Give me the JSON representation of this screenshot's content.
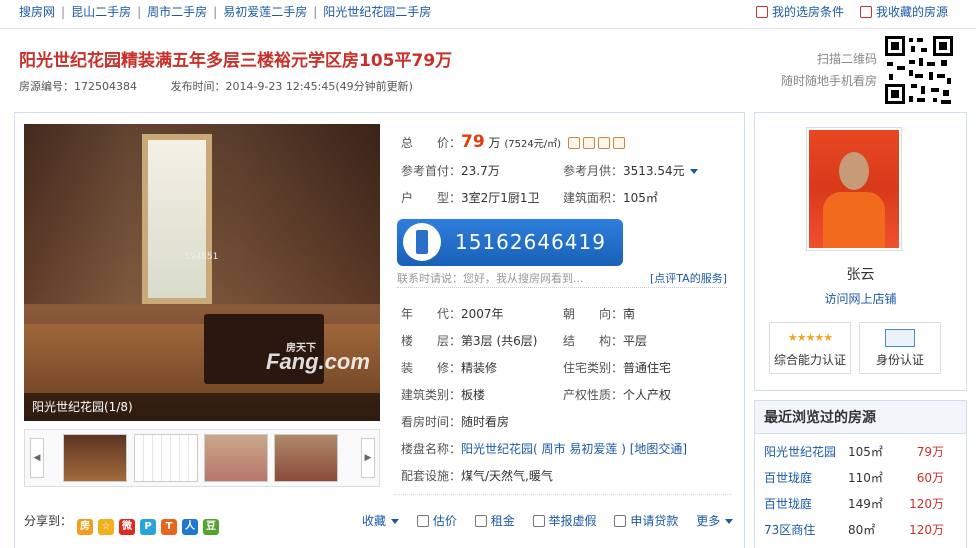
{
  "breadcrumb": [
    "搜房网",
    "昆山二手房",
    "周市二手房",
    "易初爱莲二手房",
    "阳光世纪花园二手房"
  ],
  "breadcrumb_sep": "|",
  "top_links": {
    "conditions": "我的选房条件",
    "favorites": "我收藏的房源"
  },
  "title": "阳光世纪花园精装满五年多层三楼裕元学区房105平79万",
  "meta": {
    "id": "房源编号：172504384",
    "published": "发布时间：2014-9-23 12:45:45(49分钟前更新)"
  },
  "qr": {
    "line1": "扫描二维码",
    "line2": "随时随地手机看房"
  },
  "photo": {
    "caption": "阳光世纪花园(1/8)",
    "watermark": "Fang.com",
    "watermark_small": "房天下",
    "code": "594851"
  },
  "thumbs": {
    "prev": "◀",
    "next": "▶"
  },
  "info": {
    "total_label": "总　　价：",
    "total_value": "79",
    "total_unit": "万",
    "total_extra": "(7524元/㎡)",
    "down_label": "参考首付：",
    "down_value": "23.7万",
    "monthly_label": "参考月供：",
    "monthly_value": "3513.54元",
    "layout_label": "户　　型：",
    "layout_value": "3室2厅1厨1卫",
    "area_label": "建筑面积：",
    "area_value": "105㎡",
    "year_label": "年　　代：",
    "year_value": "2007年",
    "orient_label": "朝　　向：",
    "orient_value": "南",
    "floor_label": "楼　　层：",
    "floor_value": "第3层 (共6层)",
    "struct_label": "结　　构：",
    "struct_value": "平层",
    "deco_label": "装　　修：",
    "deco_value": "精装修",
    "type_label": "住宅类别：",
    "type_value": "普通住宅",
    "btype_label": "建筑类别：",
    "btype_value": "板楼",
    "right_label": "产权性质：",
    "right_value": "个人产权",
    "view_label": "看房时间：",
    "view_value": "随时看房",
    "estate_label": "楼盘名称：",
    "estate_value": "阳光世纪花园",
    "estate_paren_open": "(",
    "estate_district": "周市",
    "estate_area": "易初爱莲",
    "estate_paren_close": ")",
    "estate_map": "[地图交通]",
    "fac_label": "配套设施：",
    "fac_value": "煤气/天然气,暖气"
  },
  "phone": {
    "number": "15162646419",
    "note": "联系时请说：您好，我从搜房网看到...",
    "review": "[点评TA的服务]"
  },
  "share": {
    "label": "分享到：",
    "icons": [
      "房",
      "☆",
      "微",
      "P",
      "T",
      "人",
      "豆"
    ],
    "colors": [
      "#f39c1f",
      "#f2b01e",
      "#e0291f",
      "#2aa2dd",
      "#e5671f",
      "#1c77d8",
      "#55a22c"
    ]
  },
  "actions": {
    "collect": "收藏",
    "estimate": "估价",
    "rent": "租金",
    "report": "举报虚假",
    "loan": "申请贷款",
    "more": "更多"
  },
  "agent": {
    "name": "张云",
    "shop_link": "访问网上店铺",
    "stars": "★★★★★",
    "cert1": "综合能力认证",
    "cert2": "身份认证"
  },
  "recent": {
    "title": "最近浏览过的房源",
    "rows": [
      {
        "name": "阳光世纪花园",
        "size": "105㎡",
        "price": "79万"
      },
      {
        "name": "百世珑庭",
        "size": "110㎡",
        "price": "60万"
      },
      {
        "name": "百世珑庭",
        "size": "149㎡",
        "price": "120万"
      },
      {
        "name": "73区商住",
        "size": "80㎡",
        "price": "120万"
      }
    ]
  }
}
